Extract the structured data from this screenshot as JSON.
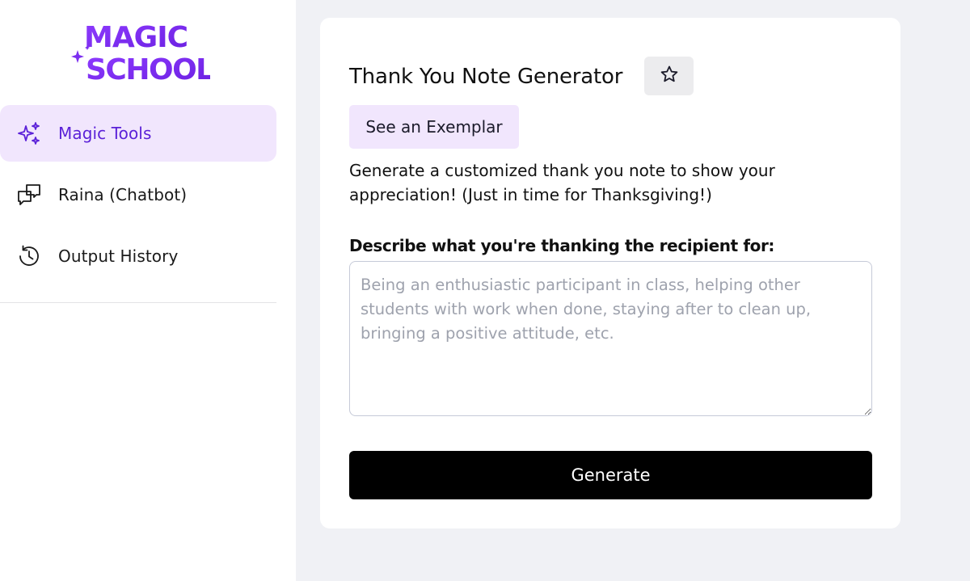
{
  "brand": {
    "logo_line1": "MAGIC",
    "logo_line2": "SCHOOL",
    "accent_color": "#7c2ff0"
  },
  "sidebar": {
    "items": [
      {
        "label": "Magic Tools",
        "icon": "sparkles-icon",
        "active": true
      },
      {
        "label": "Raina (Chatbot)",
        "icon": "chat-bubbles-icon",
        "active": false
      },
      {
        "label": "Output History",
        "icon": "history-icon",
        "active": false
      }
    ]
  },
  "tool": {
    "title": "Thank You Note Generator",
    "favorite_icon": "star-icon",
    "exemplar_label": "See an Exemplar",
    "description": "Generate a customized thank you note to show your appreciation! (Just in time for Thanksgiving!)",
    "field_label": "Describe what you're thanking the recipient for:",
    "field_value": "",
    "field_placeholder": "Being an enthusiastic participant in class, helping other students with work when done, staying after to clean up, bringing a positive attitude, etc.",
    "generate_label": "Generate"
  }
}
